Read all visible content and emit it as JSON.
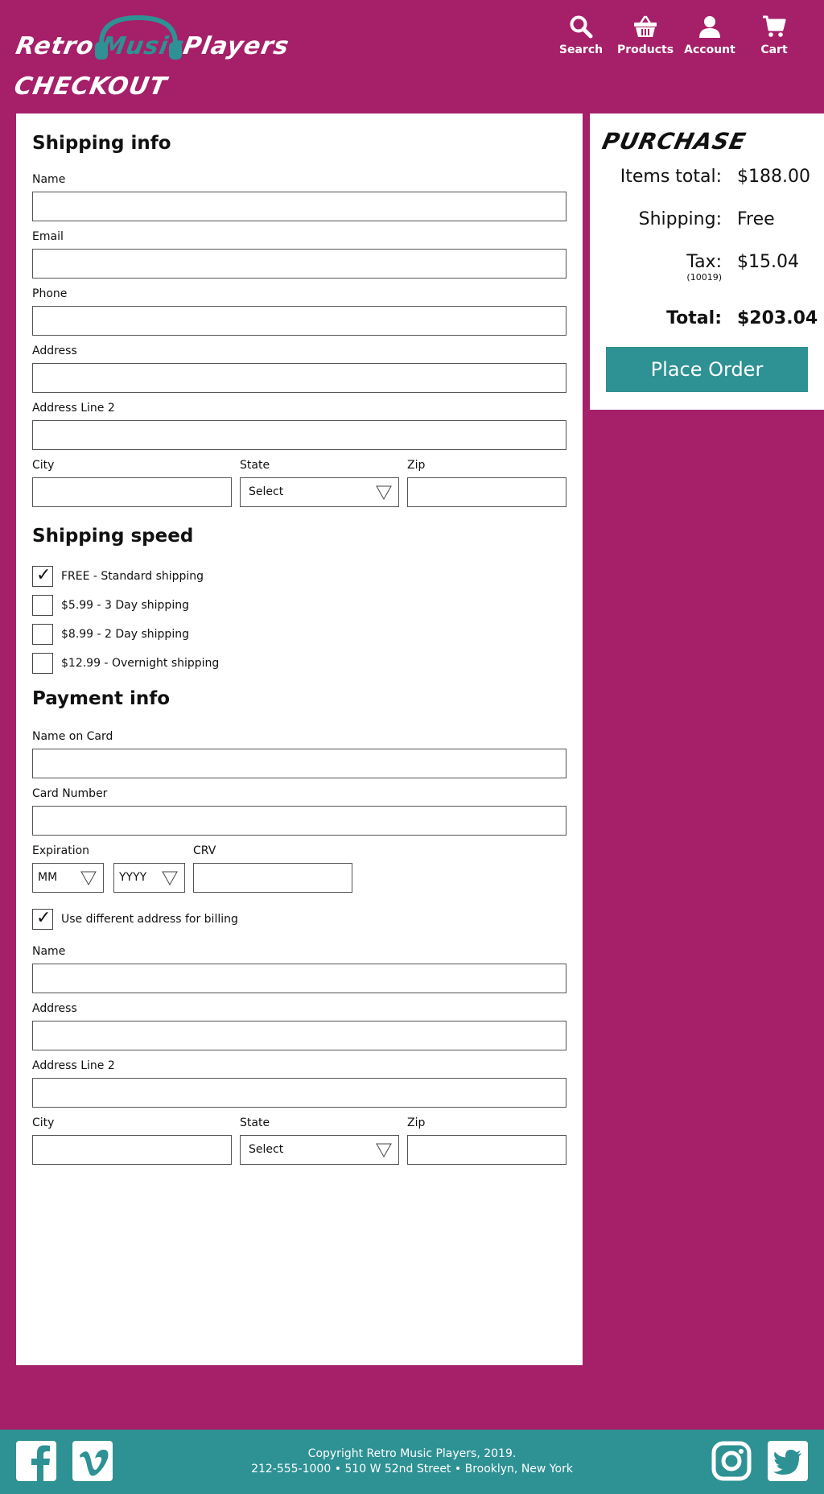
{
  "header": {
    "logo": {
      "part1": "Retro",
      "part2": "Music",
      "part3": "Players"
    },
    "nav": [
      {
        "label": "Search",
        "icon": "search-icon"
      },
      {
        "label": "Products",
        "icon": "basket-icon"
      },
      {
        "label": "Account",
        "icon": "user-icon"
      },
      {
        "label": "Cart",
        "icon": "cart-icon"
      }
    ],
    "page_title": "CHECKOUT"
  },
  "shipping": {
    "title": "Shipping info",
    "name_label": "Name",
    "email_label": "Email",
    "phone_label": "Phone",
    "address_label": "Address",
    "address2_label": "Address Line 2",
    "city_label": "City",
    "state_label": "State",
    "state_value": "Select",
    "zip_label": "Zip"
  },
  "speed": {
    "title": "Shipping speed",
    "options": [
      {
        "label": "FREE - Standard shipping",
        "checked": true
      },
      {
        "label": "$5.99 - 3 Day shipping",
        "checked": false
      },
      {
        "label": "$8.99 - 2 Day shipping",
        "checked": false
      },
      {
        "label": "$12.99 - Overnight shipping",
        "checked": false
      }
    ],
    "check_mark": "✓"
  },
  "payment": {
    "title": "Payment info",
    "name_on_card_label": "Name on Card",
    "card_number_label": "Card Number",
    "expiration_label": "Expiration",
    "month_value": "MM",
    "year_value": "YYYY",
    "crv_label": "CRV",
    "billing_checkbox_label": "Use different address for billing",
    "billing_checked": true
  },
  "billing": {
    "name_label": "Name",
    "address_label": "Address",
    "address2_label": "Address Line 2",
    "city_label": "City",
    "state_label": "State",
    "state_value": "Select",
    "zip_label": "Zip"
  },
  "purchase": {
    "title": "PURCHASE",
    "items_total_label": "Items total:",
    "items_total_value": "$188.00",
    "shipping_label": "Shipping:",
    "shipping_value": "Free",
    "tax_label": "Tax:",
    "tax_zip": "(10019)",
    "tax_value": "$15.04",
    "total_label": "Total:",
    "total_value": "$203.04",
    "place_order_label": "Place Order"
  },
  "footer": {
    "copyright": "Copyright Retro Music Players, 2019.",
    "contact": "212-555-1000 • 510 W 52nd Street • Brooklyn, New York",
    "social": [
      "facebook-icon",
      "vimeo-icon",
      "instagram-icon",
      "twitter-icon"
    ]
  },
  "colors": {
    "background": "#a61f69",
    "accent": "#2e9193",
    "panel": "#ffffff"
  }
}
